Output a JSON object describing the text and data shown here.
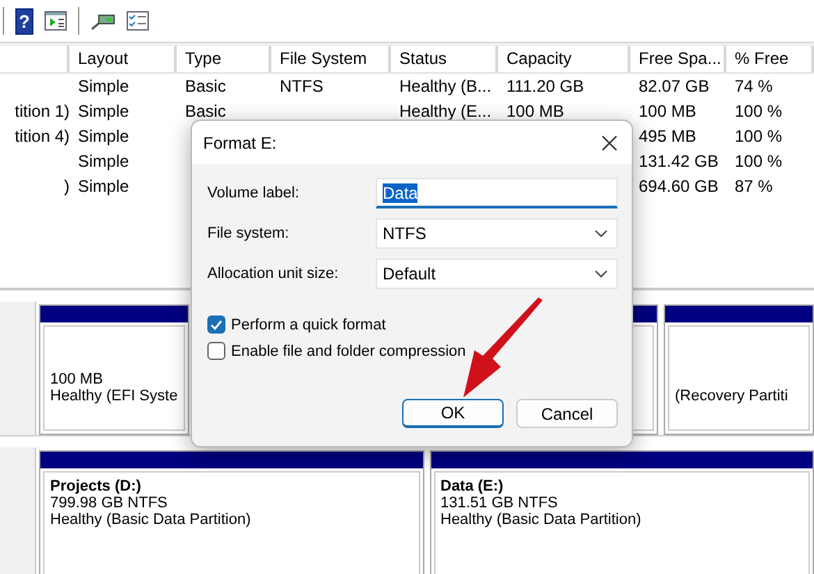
{
  "toolbar": {
    "help_icon": "?"
  },
  "table": {
    "columns": [
      "Layout",
      "Type",
      "File System",
      "Status",
      "Capacity",
      "Free Spa...",
      "% Free"
    ],
    "rows": [
      {
        "layout": "Simple",
        "type": "Basic",
        "file_system": "NTFS",
        "status": "Healthy (B...",
        "capacity": "111.20 GB",
        "free_space": "82.07 GB",
        "percent_free": "74 %"
      },
      {
        "column_1": "tition 1)",
        "layout": "Simple",
        "type": "Basic",
        "status": "Healthy (E...",
        "capacity": "100 MB",
        "free_space": "100 MB",
        "percent_free": "100 %"
      },
      {
        "column_1": "tition 4)",
        "layout": "Simple",
        "free_space": "495 MB",
        "percent_free": "100 %"
      },
      {
        "layout": "Simple",
        "free_space": "131.42 GB",
        "percent_free": "100 %"
      },
      {
        "column_1": ")",
        "layout": "Simple",
        "free_space": "694.60 GB",
        "percent_free": "87 %"
      }
    ]
  },
  "disks": [
    {
      "partitions": [
        {
          "kind": "partition",
          "lines": [
            "100 MB",
            "Healthy (EFI Syste"
          ]
        },
        {
          "kind": "partition"
        },
        {
          "kind": "partition",
          "lines": [
            "(Recovery Partiti"
          ]
        }
      ]
    },
    {
      "partitions": [
        {
          "kind": "partition",
          "title": "Projects  (D:)",
          "lines": [
            "799.98 GB NTFS",
            "Healthy (Basic Data Partition)"
          ]
        },
        {
          "kind": "partition",
          "title": "Data  (E:)",
          "lines": [
            "131.51 GB NTFS",
            "Healthy (Basic Data Partition)"
          ]
        }
      ]
    }
  ],
  "dialog": {
    "title": "Format E:",
    "fields": [
      {
        "kind": "text",
        "label": "Volume label:",
        "value": "Data",
        "selected": true
      },
      {
        "kind": "select",
        "label": "File system:",
        "value": "NTFS"
      },
      {
        "kind": "select",
        "label": "Allocation unit size:",
        "value": "Default"
      }
    ],
    "checkboxes": [
      {
        "label": "Perform a quick format",
        "checked": true
      },
      {
        "label": "Enable file and folder compression",
        "checked": false
      }
    ],
    "buttons": [
      {
        "label": "OK",
        "default": true
      },
      {
        "label": "Cancel",
        "default": false
      }
    ]
  }
}
